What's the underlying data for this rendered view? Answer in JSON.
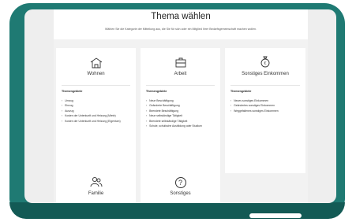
{
  "header": {
    "title": "Thema wählen",
    "subtitle": "Wählen Sie die Kategorie der Mitteilung aus, die Sie für sich oder ein Mitglied Ihrer Bedarfsgemeinschaft machen wollen."
  },
  "topics_heading": "Themengebiete",
  "cards": [
    {
      "label": "Wohnen",
      "icon": "house-icon",
      "items": [
        "Umzug",
        "Einzug",
        "Auszug",
        "Kosten der Unterkunft und Heizung (Miete)",
        "Kosten der Unterkunft und Heizung (Eigentum)"
      ]
    },
    {
      "label": "Arbeit",
      "icon": "briefcase-icon",
      "items": [
        "Neue Beschäftigung",
        "Geänderte Beschäftigung",
        "Beendete Beschäftigung",
        "Neue selbständige Tätigkeit",
        "Beendete selbständige Tätigkeit",
        "Schule, schulische Ausbildung oder Studium"
      ]
    },
    {
      "label": "Sonstiges Einkommen",
      "icon": "money-bag-icon",
      "items": [
        "Neues sonstiges Einkommen",
        "Geändertes sonstiges Einkommen",
        "Weggefallenes sonstiges Einkommen"
      ]
    },
    {
      "label": "Familie",
      "icon": "people-icon"
    },
    {
      "label": "Sonstiges",
      "icon": "help-icon",
      "glyph": "?"
    }
  ]
}
